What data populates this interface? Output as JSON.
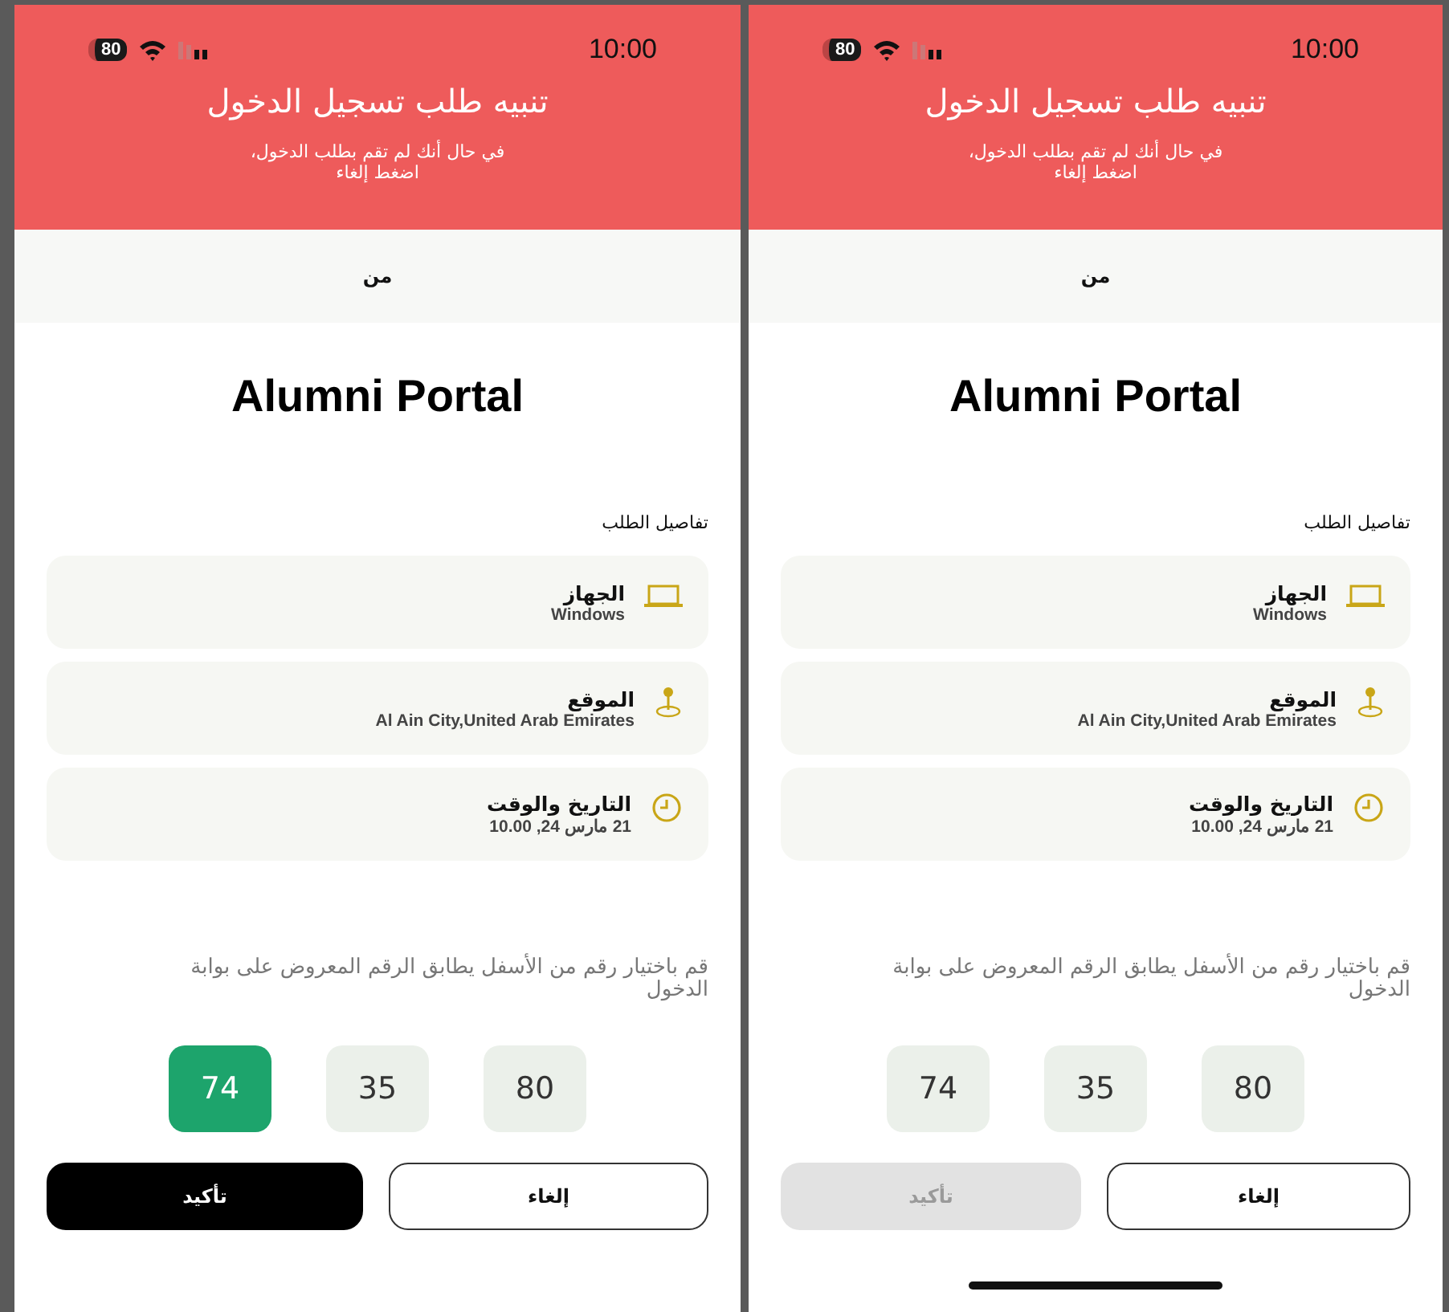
{
  "left_screen": {
    "status_bar": {
      "battery": "80",
      "time": "10:00"
    },
    "title": "تنبيه طلب تسجيل الدخول",
    "subtitle": "في حال أنك لم تقم بطلب الدخول،\nاضغط إلغاء",
    "from_label": "من",
    "app_name": "Alumni Portal",
    "details_label": "تفاصيل الطلب",
    "details": [
      {
        "kind": "device",
        "label": "الجهاز",
        "value": "Windows"
      },
      {
        "kind": "location",
        "label": "الموقع",
        "value": "Al Ain City,United Arab Emirates"
      },
      {
        "kind": "datetime",
        "label": "التاريخ والوقت",
        "value": "21 مارس 24, 10.00"
      }
    ],
    "instruction": "قم باختيار رقم من الأسفل يطابق الرقم المعروض على بوابة الدخول",
    "numbers": [
      {
        "label": "80",
        "selected": false
      },
      {
        "label": "35",
        "selected": false
      },
      {
        "label": "74",
        "selected": true
      }
    ],
    "buttons": [
      {
        "kind": "cancel",
        "label": "إلغاء"
      },
      {
        "kind": "confirm",
        "label": "تأكيد",
        "disabled": false
      }
    ],
    "home_indicator": false
  },
  "right_screen": {
    "status_bar": {
      "battery": "80",
      "time": "10:00"
    },
    "title": "تنبيه طلب تسجيل الدخول",
    "subtitle": "في حال أنك لم تقم بطلب الدخول،\nاضغط إلغاء",
    "from_label": "من",
    "app_name": "Alumni Portal",
    "details_label": "تفاصيل الطلب",
    "details": [
      {
        "kind": "device",
        "label": "الجهاز",
        "value": "Windows"
      },
      {
        "kind": "location",
        "label": "الموقع",
        "value": "Al Ain City,United Arab Emirates"
      },
      {
        "kind": "datetime",
        "label": "التاريخ والوقت",
        "value": "21 مارس 24, 10.00"
      }
    ],
    "instruction": "قم باختيار رقم من الأسفل يطابق الرقم المعروض على بوابة الدخول",
    "numbers": [
      {
        "label": "80",
        "selected": false
      },
      {
        "label": "35",
        "selected": false
      },
      {
        "label": "74",
        "selected": false
      }
    ],
    "buttons": [
      {
        "kind": "cancel",
        "label": "إلغاء"
      },
      {
        "kind": "confirm",
        "label": "تأكيد",
        "disabled": true
      }
    ],
    "home_indicator": true
  }
}
